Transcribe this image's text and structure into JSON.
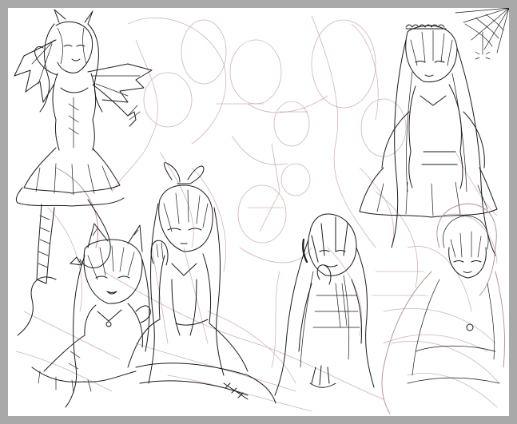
{
  "canvas": {
    "background": "#ffffff",
    "frame_color": "#a9a9a9",
    "line_color": "#1a1a1a",
    "sketch_color": "#c9a6a6",
    "marker_color": "#d93a3a"
  },
  "figures": [
    {
      "name": "winged-demon-girl"
    },
    {
      "name": "cat-eared-girl"
    },
    {
      "name": "ribbon-bow-girl"
    },
    {
      "name": "long-haired-girl-center-right"
    },
    {
      "name": "maid-headband-girl"
    },
    {
      "name": "hooded-girl"
    }
  ],
  "spider": {
    "name": "spider-on-web"
  }
}
